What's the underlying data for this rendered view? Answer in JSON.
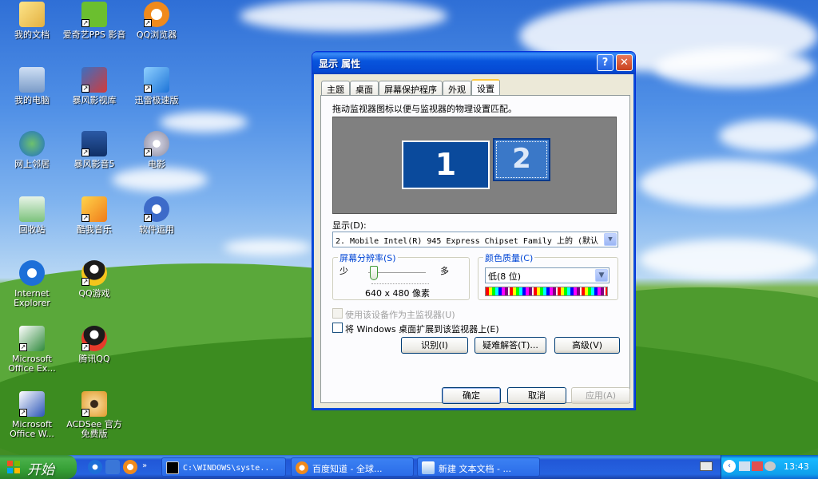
{
  "desktop": {
    "icons": [
      {
        "label": "我的文档",
        "icon": "my-documents-icon"
      },
      {
        "label": "爱奇艺PPS 影音",
        "icon": "iqiyi-pps-icon"
      },
      {
        "label": "QQ浏览器",
        "icon": "qq-browser-icon"
      },
      {
        "label": "我的电脑",
        "icon": "my-computer-icon"
      },
      {
        "label": "暴风影视库",
        "icon": "baofeng-library-icon"
      },
      {
        "label": "迅雷极速版",
        "icon": "xunlei-icon"
      },
      {
        "label": "网上邻居",
        "icon": "network-places-icon"
      },
      {
        "label": "暴风影音5",
        "icon": "baofeng-player-icon"
      },
      {
        "label": "电影",
        "icon": "movie-icon"
      },
      {
        "label": "回收站",
        "icon": "recycle-bin-icon"
      },
      {
        "label": "酷我音乐",
        "icon": "kuwo-music-icon"
      },
      {
        "label": "软件运用",
        "icon": "software-icon"
      },
      {
        "label": "Internet Explorer",
        "icon": "internet-explorer-icon"
      },
      {
        "label": "QQ游戏",
        "icon": "qq-game-icon"
      },
      {
        "label": "Microsoft Office Ex...",
        "icon": "excel-icon"
      },
      {
        "label": "腾讯QQ",
        "icon": "tencent-qq-icon"
      },
      {
        "label": "Microsoft Office W...",
        "icon": "word-icon"
      },
      {
        "label": "ACDSee 官方免费版",
        "icon": "acdsee-icon"
      }
    ]
  },
  "dialog": {
    "title": "显示 属性",
    "help_label": "?",
    "close_label": "✕",
    "tabs": [
      "主题",
      "桌面",
      "屏幕保护程序",
      "外观",
      "设置"
    ],
    "active_tab": "设置",
    "instruction": "拖动监视器图标以便与监视器的物理设置匹配。",
    "monitor1": "1",
    "monitor2": "2",
    "display_label": "显示(D):",
    "display_value": "2. Mobile Intel(R) 945 Express Chipset Family 上的 (默认",
    "resolution_title": "屏幕分辨率(S)",
    "resolution_less": "少",
    "resolution_more": "多",
    "resolution_value": "640 x 480 像素",
    "color_title": "颜色质量(C)",
    "color_value": "低(8 位)",
    "primary_label": "使用该设备作为主监视器(U)",
    "extend_label": "将 Windows 桌面扩展到该监视器上(E)",
    "identify_label": "识别(I)",
    "troubleshoot_label": "疑难解答(T)...",
    "advanced_label": "高级(V)",
    "ok_label": "确定",
    "cancel_label": "取消",
    "apply_label": "应用(A)"
  },
  "taskbar": {
    "start_label": "开始",
    "tasks": [
      {
        "label": "C:\\WINDOWS\\syste...",
        "icon": "cmd-icon"
      },
      {
        "label": "百度知道 - 全球...",
        "icon": "browser-icon"
      },
      {
        "label": "新建 文本文档 - ...",
        "icon": "notepad-icon"
      }
    ],
    "clock": "13:43"
  }
}
